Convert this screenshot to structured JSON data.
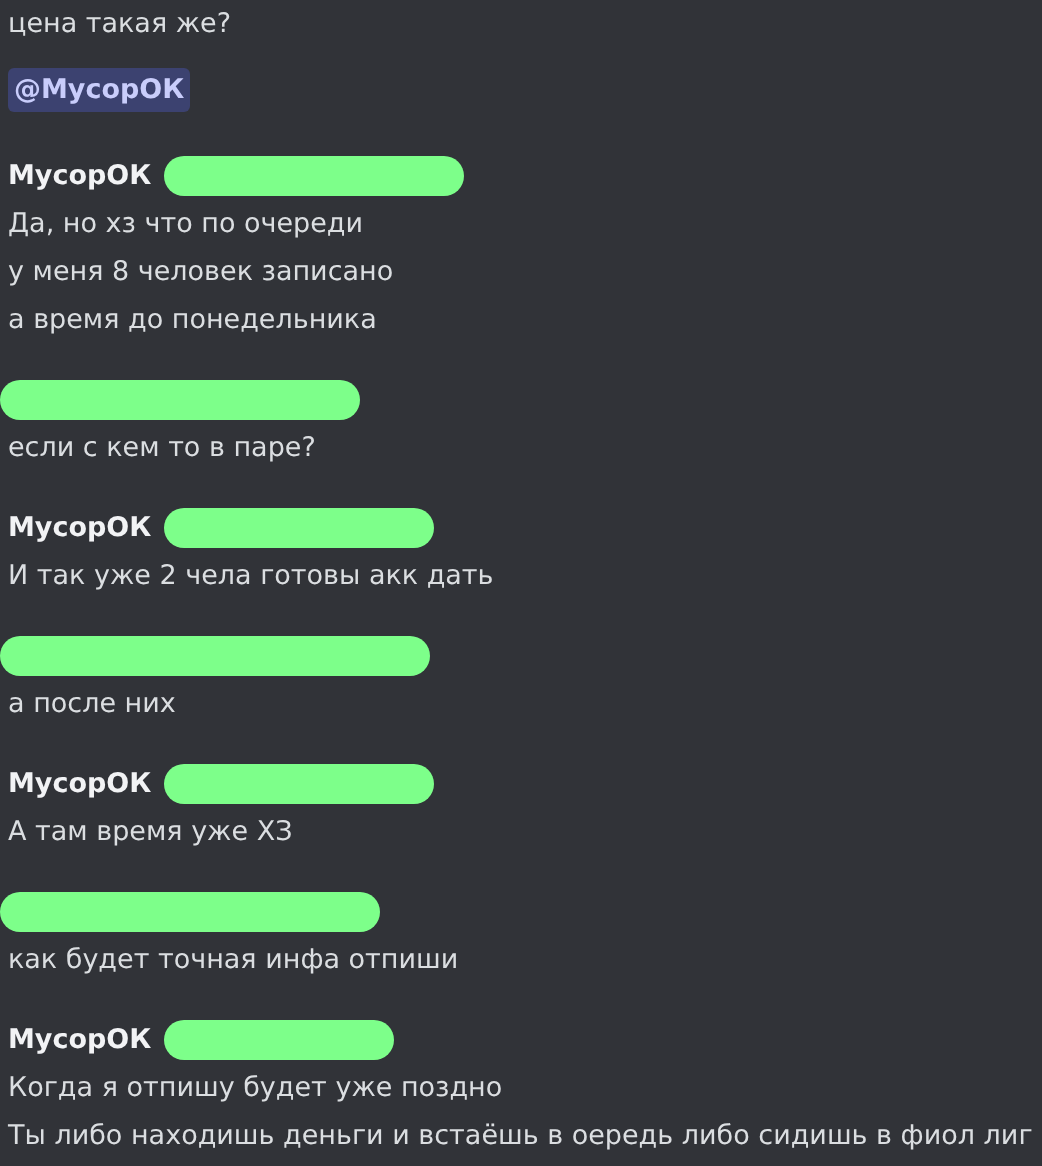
{
  "top_lines": [
    "цена такая же?"
  ],
  "mention": "@МусорОК",
  "groups": [
    {
      "author": "МусорОК",
      "lines": [
        "Да, но хз что по очереди",
        "у меня 8 человек записано",
        "а время до понедельника"
      ]
    },
    {
      "lines": [
        "если с кем то в паре?"
      ]
    },
    {
      "author": "МусорОК",
      "lines": [
        "И так уже 2 чела готовы акк дать"
      ]
    },
    {
      "lines": [
        "а после них"
      ]
    },
    {
      "author": "МусорОК",
      "lines": [
        "А там время уже ХЗ"
      ]
    },
    {
      "lines": [
        "как будет точная инфа отпиши"
      ]
    },
    {
      "author": "МусорОК",
      "lines": [
        "Когда я отпишу будет уже поздно",
        "Ты либо находишь деньги и встаёшь в оередь либо сидишь в фиол лиг"
      ]
    }
  ]
}
